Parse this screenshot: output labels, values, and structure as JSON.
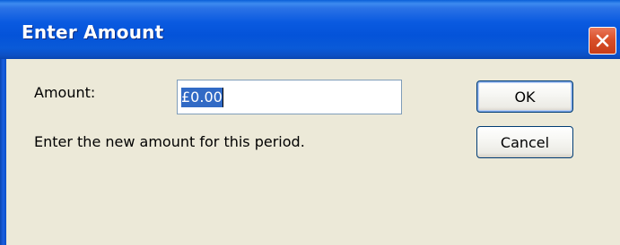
{
  "window": {
    "title": "Enter Amount"
  },
  "form": {
    "amount_label": "Amount:",
    "amount_value": "£0.00",
    "hint": "Enter the new amount for this period."
  },
  "buttons": {
    "ok_label": "OK",
    "cancel_label": "Cancel"
  },
  "colors": {
    "titlebar": "#0453d9",
    "dialog_background": "#ece9d8",
    "close_button": "#d9502a",
    "selection": "#316ac5"
  },
  "icons": {
    "close": "close-icon"
  }
}
